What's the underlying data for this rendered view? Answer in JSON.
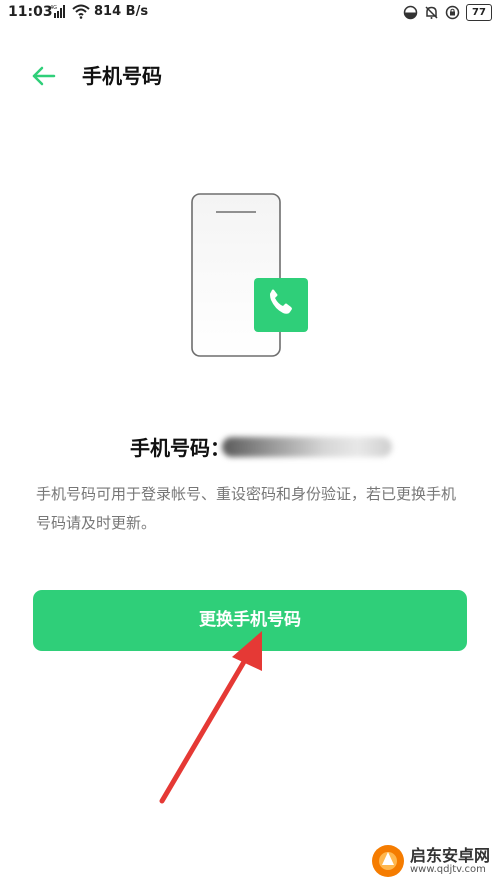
{
  "status_bar": {
    "time": "11:03",
    "network": "4G",
    "speed": "814 B/s",
    "battery": "77"
  },
  "header": {
    "title": "手机号码",
    "back_icon": "arrow-left-icon"
  },
  "phone": {
    "label": "手机号码："
  },
  "description": "手机号码可用于登录帐号、重设密码和身份验证，若已更换手机号码请及时更新。",
  "actions": {
    "change_label": "更换手机号码"
  },
  "watermark": {
    "title": "启东安卓网",
    "url": "www.qdjtv.com"
  },
  "colors": {
    "accent": "#2fcf79",
    "annotation": "#e53935"
  }
}
